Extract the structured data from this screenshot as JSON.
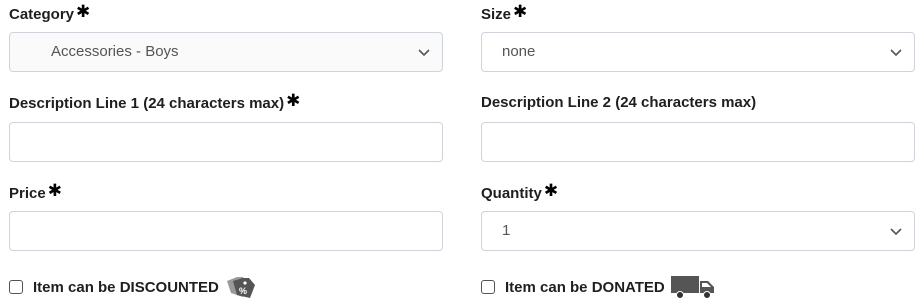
{
  "required_mark": "✱",
  "category": {
    "label": "Category",
    "selected": "Accessories - Boys"
  },
  "size": {
    "label": "Size",
    "selected": "none"
  },
  "desc1": {
    "label": "Description Line 1 (24 characters max)",
    "value": ""
  },
  "desc2": {
    "label": "Description Line 2 (24 characters max)",
    "value": ""
  },
  "price": {
    "label": "Price",
    "value": ""
  },
  "quantity": {
    "label": "Quantity",
    "selected": "1"
  },
  "discount": {
    "label": "Item can be DISCOUNTED",
    "checked": false,
    "icon": "discount-tag-icon"
  },
  "donate": {
    "label": "Item can be DONATED",
    "checked": false,
    "icon": "delivery-truck-icon"
  },
  "colors": {
    "border": "#cfd4da",
    "label_text": "#1f1f1f",
    "value_text": "#555555"
  }
}
